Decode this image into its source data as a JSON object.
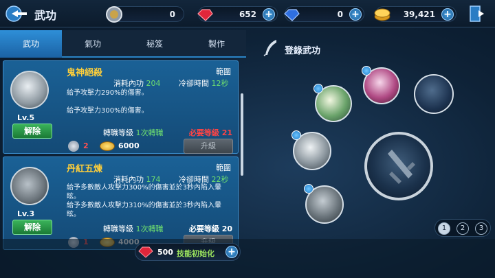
{
  "header": {
    "title": "武功",
    "currencies": [
      {
        "icon": "silver-orb-icon",
        "value": "0",
        "has_plus": false
      },
      {
        "icon": "red-gem-icon",
        "value": "652",
        "has_plus": true
      },
      {
        "icon": "blue-gem-icon",
        "value": "0",
        "has_plus": true
      },
      {
        "icon": "gold-coin-icon",
        "value": "39,421",
        "has_plus": true
      }
    ],
    "plus": "+"
  },
  "tabs": [
    {
      "label": "武功",
      "active": true
    },
    {
      "label": "氣功",
      "active": false
    },
    {
      "label": "秘笈",
      "active": false
    },
    {
      "label": "製作",
      "active": false
    }
  ],
  "skills": [
    {
      "name": "鬼神絕殺",
      "range": "範圍",
      "cost_label": "消耗內功",
      "cost_value": "204",
      "cd_label": "冷卻時間",
      "cd_value": "12秒",
      "desc1": "給予攻擊力290%的傷害。",
      "desc2": "給予攻擊力300%的傷害。",
      "advance_label": "轉職等級",
      "advance_value": "1次轉職",
      "req": "必要等級 21",
      "req_ok": false,
      "level": "Lv.5",
      "unlearn": "解除",
      "orb_cost": "2",
      "gold_cost": "6000",
      "upgrade": "升級"
    },
    {
      "name": "丹紅五煉",
      "range": "範圍",
      "cost_label": "消耗內功",
      "cost_value": "174",
      "cd_label": "冷卻時間",
      "cd_value": "22秒",
      "desc1": "給予多數敵人攻擊力300%的傷害並於3秒內陷入暈眩。",
      "desc2": "給予多數敵人攻擊力310%的傷害並於3秒內陷入暈眩。",
      "advance_label": "轉職等級",
      "advance_value": "1次轉職",
      "req": "必要等級 20",
      "req_ok": true,
      "level": "Lv.3",
      "unlearn": "解除",
      "orb_cost": "1",
      "gold_cost": "4000",
      "upgrade": "升級"
    }
  ],
  "reset": {
    "value": "500",
    "label": "技能初始化"
  },
  "register": {
    "label": "登錄武功"
  },
  "pages": [
    "1",
    "2",
    "3"
  ],
  "colors": {
    "accent": "#2e8fd8",
    "gold_text": "#ffcf3a",
    "green_text": "#6fe06f",
    "red_text": "#ff4444"
  }
}
